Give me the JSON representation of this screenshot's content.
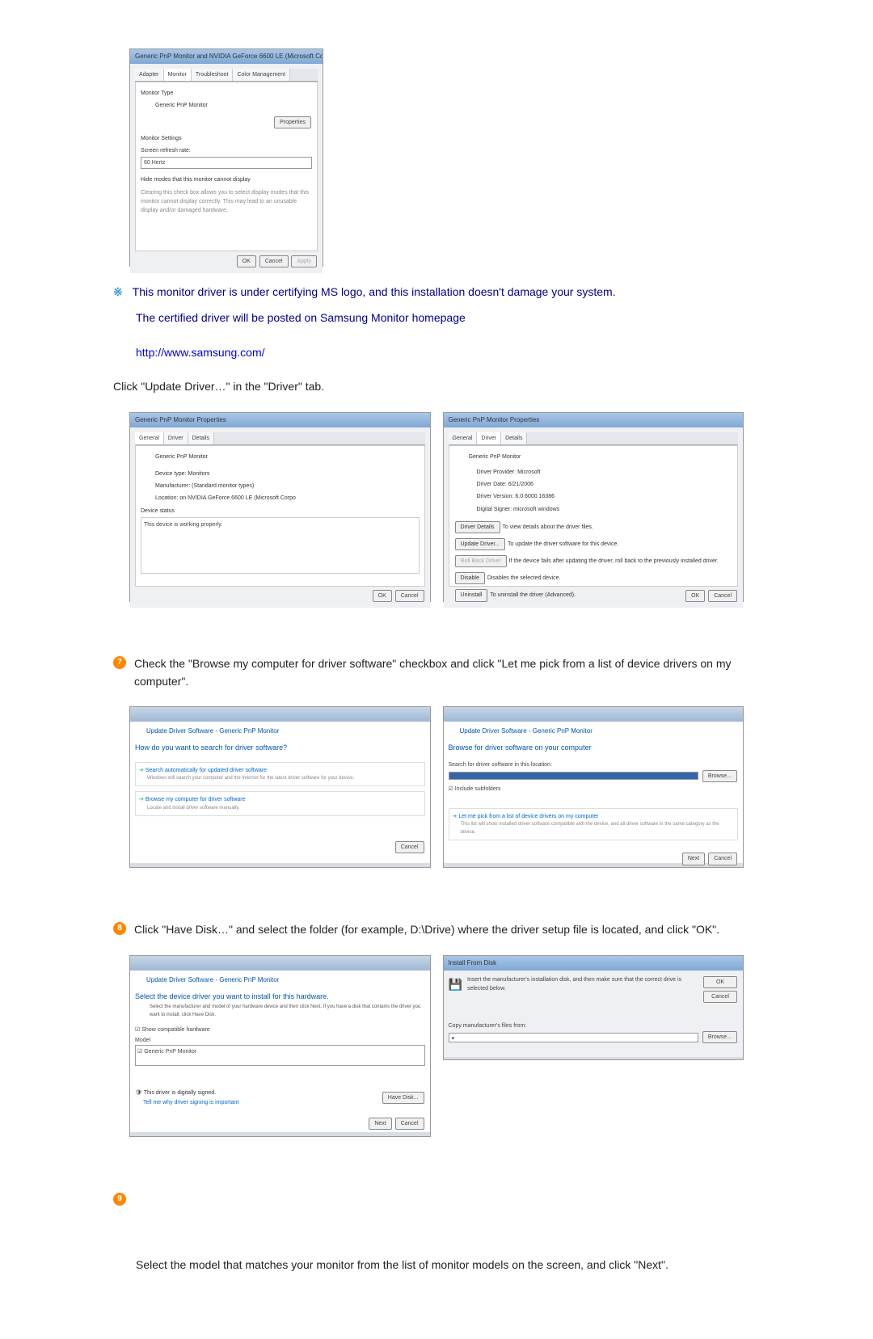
{
  "screenshot1": {
    "title": "Generic PnP Monitor and NVIDIA GeForce 6600 LE (Microsoft Co...",
    "tabs": [
      "Adapter",
      "Monitor",
      "Troubleshoot",
      "Color Management"
    ],
    "monitor_type_label": "Monitor Type",
    "monitor_type_value": "Generic PnP Monitor",
    "properties_btn": "Properties",
    "monitor_settings_label": "Monitor Settings",
    "refresh_label": "Screen refresh rate:",
    "refresh_value": "60 Hertz",
    "hide_modes_check": "Hide modes that this monitor cannot display",
    "hide_modes_desc": "Clearing this check box allows you to select display modes that this monitor cannot display correctly. This may lead to an unusable display and/or damaged hardware.",
    "ok": "OK",
    "cancel": "Cancel",
    "apply": "Apply"
  },
  "note": {
    "line1": "This monitor driver is under certifying MS logo, and this installation doesn't damage your system.",
    "line2": "The certified driver will be posted on Samsung Monitor homepage",
    "link": "http://www.samsung.com/"
  },
  "step_update": "Click \"Update Driver…\" in the \"Driver\" tab.",
  "props_general": {
    "title": "Generic PnP Monitor Properties",
    "tabs": [
      "General",
      "Driver",
      "Details"
    ],
    "device_name": "Generic PnP Monitor",
    "device_type_label": "Device type:",
    "device_type": "Monitors",
    "manufacturer_label": "Manufacturer:",
    "manufacturer": "(Standard monitor types)",
    "location_label": "Location:",
    "location": "on NVIDIA GeForce 6600 LE (Microsoft Corpo",
    "device_status_label": "Device status",
    "device_status": "This device is working properly.",
    "ok": "OK",
    "cancel": "Cancel"
  },
  "props_driver": {
    "title": "Generic PnP Monitor Properties",
    "tabs": [
      "General",
      "Driver",
      "Details"
    ],
    "device_name": "Generic PnP Monitor",
    "provider_label": "Driver Provider:",
    "provider": "Microsoft",
    "date_label": "Driver Date:",
    "date": "6/21/2006",
    "version_label": "Driver Version:",
    "version": "6.0.6000.16386",
    "signer_label": "Digital Signer:",
    "signer": "microsoft windows",
    "btn_details": "Driver Details",
    "details_desc": "To view details about the driver files.",
    "btn_update": "Update Driver...",
    "update_desc": "To update the driver software for this device.",
    "btn_rollback": "Roll Back Driver",
    "rollback_desc": "If the device fails after updating the driver, roll back to the previously installed driver.",
    "btn_disable": "Disable",
    "disable_desc": "Disables the selected device.",
    "btn_uninstall": "Uninstall",
    "uninstall_desc": "To uninstall the driver (Advanced).",
    "ok": "OK",
    "cancel": "Cancel"
  },
  "step7": {
    "num": "7",
    "text": "Check the \"Browse my computer for driver software\" checkbox and click \"Let me pick from a list of device drivers on my computer\"."
  },
  "wizard1_left": {
    "title": "Update Driver Software - Generic PnP Monitor",
    "heading": "How do you want to search for driver software?",
    "opt1_title": "Search automatically for updated driver software",
    "opt1_desc": "Windows will search your computer and the Internet for the latest driver software for your device.",
    "opt2_title": "Browse my computer for driver software",
    "opt2_desc": "Locate and install driver software manually.",
    "cancel": "Cancel"
  },
  "wizard1_right": {
    "title": "Update Driver Software - Generic PnP Monitor",
    "heading": "Browse for driver software on your computer",
    "search_label": "Search for driver software in this location:",
    "browse": "Browse...",
    "include_sub": "Include subfolders",
    "opt_title": "Let me pick from a list of device drivers on my computer",
    "opt_desc": "This list will show installed driver software compatible with the device, and all driver software in the same category as the device.",
    "next": "Next",
    "cancel": "Cancel"
  },
  "step8": {
    "num": "8",
    "text": "Click \"Have Disk…\" and select the folder (for example, D:\\Drive) where the driver setup file is located, and click \"OK\"."
  },
  "wizard2_left": {
    "title": "Update Driver Software - Generic PnP Monitor",
    "heading": "Select the device driver you want to install for this hardware.",
    "desc": "Select the manufacturer and model of your hardware device and then click Next. If you have a disk that contains the driver you want to install, click Have Disk.",
    "show_compat": "Show compatible hardware",
    "model_label": "Model",
    "model_value": "Generic PnP Monitor",
    "signed": "This driver is digitally signed.",
    "signed_link": "Tell me why driver signing is important",
    "have_disk": "Have Disk...",
    "next": "Next",
    "cancel": "Cancel"
  },
  "wizard2_right": {
    "title": "Install From Disk",
    "text": "Insert the manufacturer's installation disk, and then make sure that the correct drive is selected below.",
    "ok": "OK",
    "cancel": "Cancel",
    "copy_label": "Copy manufacturer's files from:",
    "browse": "Browse..."
  },
  "step9": {
    "num": "9",
    "text": "Select the model that matches your monitor from the list of monitor models on the screen, and click \"Next\"."
  }
}
